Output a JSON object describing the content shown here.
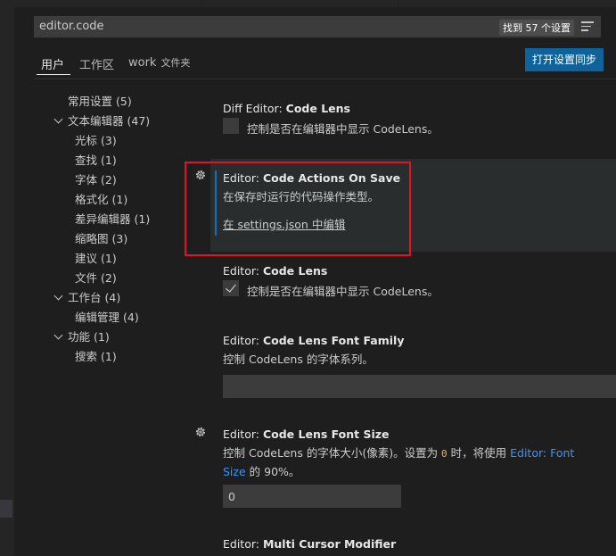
{
  "search": {
    "value": "editor.code",
    "result_count": "找到 57 个设置"
  },
  "tabs": [
    {
      "label": "用户"
    },
    {
      "label": "工作区"
    },
    {
      "label": "work",
      "sub": "文件夹"
    }
  ],
  "sync_button": "打开设置同步",
  "toc": [
    {
      "label": "常用设置",
      "count": "(5)"
    },
    {
      "label": "文本编辑器",
      "count": "(47)"
    },
    {
      "label": "光标",
      "count": "(3)"
    },
    {
      "label": "查找",
      "count": "(1)"
    },
    {
      "label": "字体",
      "count": "(2)"
    },
    {
      "label": "格式化",
      "count": "(1)"
    },
    {
      "label": "差异编辑器",
      "count": "(1)"
    },
    {
      "label": "缩略图",
      "count": "(3)"
    },
    {
      "label": "建议",
      "count": "(1)"
    },
    {
      "label": "文件",
      "count": "(2)"
    },
    {
      "label": "工作台",
      "count": "(4)"
    },
    {
      "label": "编辑管理",
      "count": "(4)"
    },
    {
      "label": "功能",
      "count": "(1)"
    },
    {
      "label": "搜索",
      "count": "(1)"
    }
  ],
  "settings": {
    "diff_code_lens": {
      "category": "Diff Editor: ",
      "name": "Code Lens",
      "checkbox_label": "控制是否在编辑器中显示 CodeLens。",
      "checked": false
    },
    "code_actions_on_save": {
      "category": "Editor: ",
      "name": "Code Actions On Save",
      "description": "在保存时运行的代码操作类型。",
      "link": "在 settings.json 中编辑"
    },
    "code_lens": {
      "category": "Editor: ",
      "name": "Code Lens",
      "checkbox_label": "控制是否在编辑器中显示 CodeLens。",
      "checked": true
    },
    "code_lens_font_family": {
      "category": "Editor: ",
      "name": "Code Lens Font Family",
      "description": "控制 CodeLens 的字体系列。",
      "value": ""
    },
    "code_lens_font_size": {
      "category": "Editor: ",
      "name": "Code Lens Font Size",
      "desc_part1": "控制 CodeLens 的字体大小(像素)。设置为 ",
      "desc_code": "0",
      "desc_part2": " 时，将使用 ",
      "desc_link1": "Editor: Font",
      "desc_link2": "Size",
      "desc_part3": " 的 90%。",
      "value": "0"
    },
    "multi_cursor_modifier": {
      "category": "Editor: ",
      "name": "Multi Cursor Modifier"
    }
  }
}
